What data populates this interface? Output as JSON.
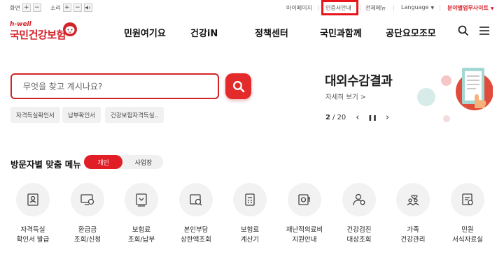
{
  "utility": {
    "screen_label": "화면",
    "sound_label": "소리",
    "plus": "+",
    "minus": "−",
    "links": [
      "마이페이지",
      "인증서안내",
      "전체메뉴"
    ],
    "language": "Language",
    "field_site": "분야별업무사이트",
    "caret": "▼"
  },
  "logo": {
    "tagline": "h-well",
    "name": "국민건강보험"
  },
  "nav": [
    "민원여기요",
    "건강iN",
    "정책센터",
    "국민과함께",
    "공단요모조모"
  ],
  "search": {
    "placeholder": "무엇을 찾고 계시나요?",
    "tags": [
      "자격득실확인서",
      "납부확인서",
      "건강보험자격득실.."
    ]
  },
  "banner": {
    "title": "대외수감결과",
    "more": "자세히 보기 >",
    "page_current": "2",
    "page_total": "/ 20",
    "prev": "‹",
    "pause": "❚❚",
    "next": "›"
  },
  "menu": {
    "title": "방문자별 맞춤 메뉴",
    "tabs": [
      "개인",
      "사업장"
    ],
    "items": [
      "자격득실\n확인서 발급",
      "환급금\n조회/신청",
      "보험료\n조회/납부",
      "본인부담\n상한액조회",
      "보험료\n계산기",
      "재난적의료비\n지원안내",
      "건강검진\n대상조회",
      "가족\n건강관리",
      "민원\n서식자료실"
    ]
  },
  "colors": {
    "brand_red": "#d3232a",
    "highlight_box": "#e8141c"
  }
}
